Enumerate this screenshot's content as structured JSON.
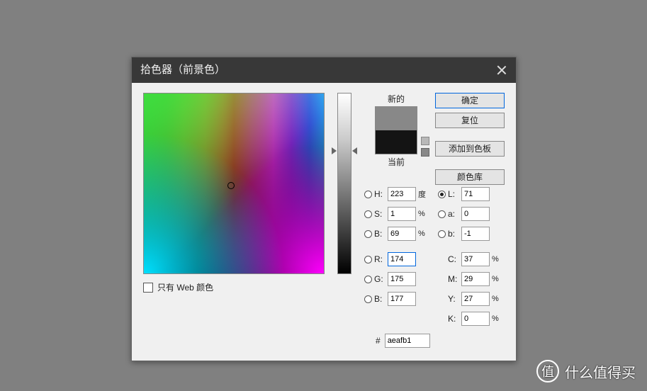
{
  "dialog": {
    "title": "拾色器（前景色）",
    "swatch_new_label": "新的",
    "swatch_cur_label": "当前",
    "webonly_label": "只有 Web 颜色",
    "hex_prefix": "#",
    "hex_value": "aeafb1",
    "buttons": {
      "ok": "确定",
      "cancel": "复位",
      "add_swatch": "添加到色板",
      "libraries": "颜色库"
    },
    "fields": {
      "H": {
        "label": "H:",
        "value": "223",
        "unit": "度"
      },
      "S": {
        "label": "S:",
        "value": "1",
        "unit": "%"
      },
      "B": {
        "label": "B:",
        "value": "69",
        "unit": "%"
      },
      "R": {
        "label": "R:",
        "value": "174"
      },
      "G": {
        "label": "G:",
        "value": "175"
      },
      "Bl": {
        "label": "B:",
        "value": "177"
      },
      "L": {
        "label": "L:",
        "value": "71"
      },
      "a": {
        "label": "a:",
        "value": "0"
      },
      "b": {
        "label": "b:",
        "value": "-1"
      },
      "C": {
        "label": "C:",
        "value": "37",
        "unit": "%"
      },
      "M": {
        "label": "M:",
        "value": "29",
        "unit": "%"
      },
      "Y": {
        "label": "Y:",
        "value": "27",
        "unit": "%"
      },
      "K": {
        "label": "K:",
        "value": "0",
        "unit": "%"
      }
    },
    "colors": {
      "new": "#888888",
      "current": "#141414"
    }
  },
  "watermark": {
    "badge": "值",
    "text": "什么值得买"
  }
}
